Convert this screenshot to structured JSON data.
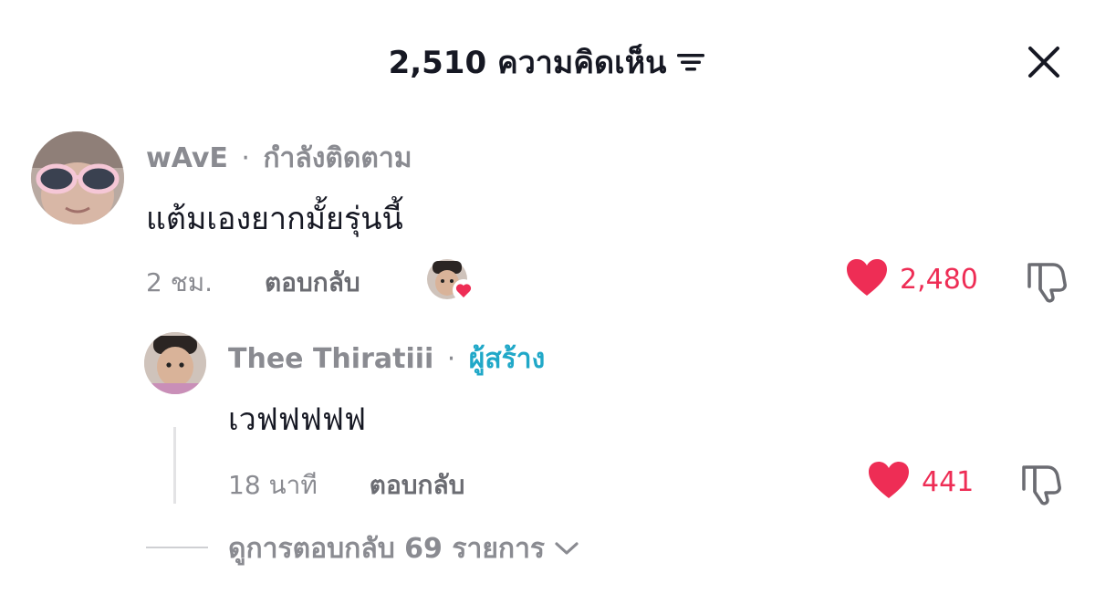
{
  "header": {
    "comment_count_label": "2,510 ความคิดเห็น",
    "sort_icon": "sort-lines-icon",
    "close_icon": "close-icon"
  },
  "comments": [
    {
      "username": "wAvE",
      "separator": "·",
      "relation": "กำลังติดตาม",
      "text": "แต้มเองยากมั้ยรุ่นนี้",
      "time": "2 ชม.",
      "reply_label": "ตอบกลับ",
      "like_count": "2,480",
      "liked_by_creator": true
    }
  ],
  "reply": {
    "username": "Thee Thiratiii",
    "separator": "·",
    "badge": "ผู้สร้าง",
    "text": "เวฟฟฟฟฟ",
    "time": "18 นาที",
    "reply_label": "ตอบกลับ",
    "like_count": "441"
  },
  "view_more_label": "ดูการตอบกลับ 69 รายการ",
  "colors": {
    "like": "#ee2d55",
    "creator_badge": "#20a8c8",
    "muted": "#8a8b91"
  }
}
